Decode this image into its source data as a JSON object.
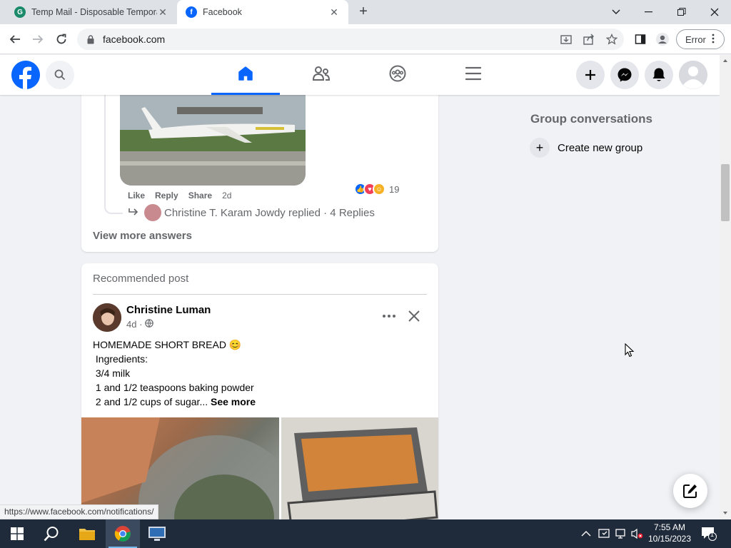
{
  "browser": {
    "tabs": [
      {
        "title": "Temp Mail - Disposable Temporary",
        "close": "✕"
      },
      {
        "title": "Facebook",
        "close": "✕"
      }
    ],
    "new_tab": "+",
    "address": "facebook.com",
    "profile_status": "Error",
    "status_url": "https://www.facebook.com/notifications/"
  },
  "comment_thread": {
    "actions": [
      "Like",
      "Reply",
      "Share"
    ],
    "time": "2d",
    "reaction_count": "19",
    "replied_text": "Christine T. Karam Jowdy replied · 4 Replies",
    "view_more": "View more answers"
  },
  "post": {
    "section_label": "Recommended post",
    "author": "Christine Luman",
    "time": "4d ·",
    "lines": [
      "HOMEMADE SHORT BREAD 😊",
      " Ingredients:",
      " 3/4 milk",
      " 1 and 1/2 teaspoons baking powder",
      " 2 and 1/2 cups of sugar... "
    ],
    "see_more": "See more"
  },
  "right_column": {
    "title": "Group conversations",
    "create_group": "Create new group"
  },
  "taskbar": {
    "time": "7:55 AM",
    "date": "10/15/2023",
    "notification_count": "1"
  },
  "colors": {
    "facebook_blue": "#0866ff",
    "taskbar": "#1f2a3a"
  }
}
